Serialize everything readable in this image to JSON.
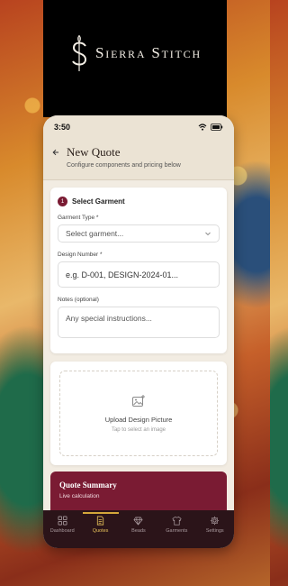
{
  "brand": {
    "name": "Sierra Stitch"
  },
  "status_bar": {
    "time": "3:50"
  },
  "header": {
    "title": "New Quote",
    "subtitle": "Configure components and pricing below"
  },
  "garment_section": {
    "step": "1",
    "title": "Select Garment",
    "garment_type_label": "Garment Type *",
    "garment_type_value": "Select garment...",
    "design_number_label": "Design Number *",
    "design_number_placeholder": "e.g. D-001, DESIGN-2024-01...",
    "notes_label": "Notes (optional)",
    "notes_placeholder": "Any special instructions..."
  },
  "upload": {
    "label": "Upload Design Picture",
    "hint": "Tap to select an image"
  },
  "summary": {
    "title": "Quote Summary",
    "subtitle": "Live calculation"
  },
  "tabs": [
    {
      "label": "Dashboard",
      "icon": "grid-icon"
    },
    {
      "label": "Quotes",
      "icon": "document-icon",
      "active": true
    },
    {
      "label": "Beads",
      "icon": "diamond-icon"
    },
    {
      "label": "Garments",
      "icon": "shirt-icon"
    },
    {
      "label": "Settings",
      "icon": "gear-icon"
    }
  ],
  "colors": {
    "accent": "#7a1b33",
    "tab_active": "#e6c15a",
    "tabbar_bg": "#2b1419",
    "brand_bg": "#000000"
  }
}
